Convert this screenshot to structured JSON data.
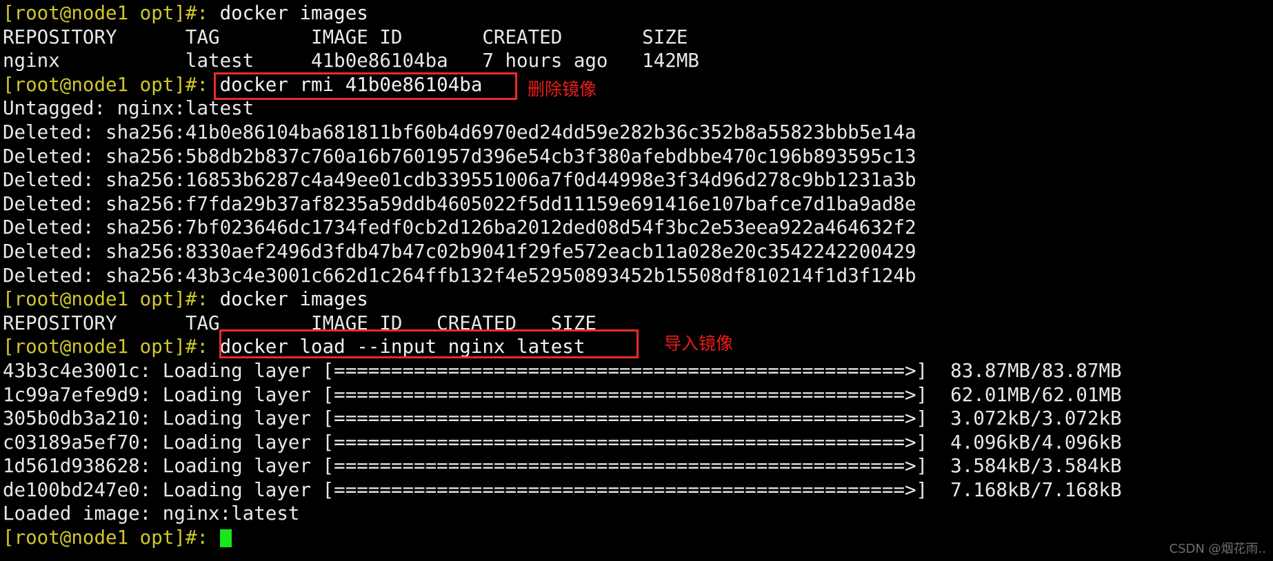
{
  "terminal": {
    "prompt": "[root@node1 opt]#:",
    "colors": {
      "background": "#000000",
      "prompt": "#d2c72b",
      "output": "#e8e8e8",
      "cursor": "#19e619",
      "annotation": "#ef1a1a",
      "highlight_border": "#ee2b2b"
    },
    "lines": {
      "l01_cmd": " docker images",
      "l02": "REPOSITORY      TAG        IMAGE ID       CREATED       SIZE",
      "l03": "nginx           latest     41b0e86104ba   7 hours ago   142MB",
      "l04_cmd": " docker rmi 41b0e86104ba",
      "l05": "Untagged: nginx:latest",
      "l06": "Deleted: sha256:41b0e86104ba681811bf60b4d6970ed24dd59e282b36c352b8a55823bbb5e14a",
      "l07": "Deleted: sha256:5b8db2b837c760a16b7601957d396e54cb3f380afebdbbe470c196b893595c13",
      "l08": "Deleted: sha256:16853b6287c4a49ee01cdb339551006a7f0d44998e3f34d96d278c9bb1231a3b",
      "l09": "Deleted: sha256:f7fda29b37af8235a59ddb4605022f5dd11159e691416e107bafce7d1ba9ad8e",
      "l10": "Deleted: sha256:7bf023646dc1734fedf0cb2d126ba2012ded08d54f3bc2e53eea922a464632f2",
      "l11": "Deleted: sha256:8330aef2496d3fdb47b47c02b9041f29fe572eacb11a028e20c3542242200429",
      "l12": "Deleted: sha256:43b3c4e3001c662d1c264ffb132f4e52950893452b15508df810214f1d3f124b",
      "l13_cmd": " docker images",
      "l14": "REPOSITORY      TAG        IMAGE ID   CREATED   SIZE",
      "l15_cmd": " docker load --input nginx_latest",
      "l16": "43b3c4e3001c: Loading layer [==================================================>]  83.87MB/83.87MB",
      "l17": "1c99a7efe9d9: Loading layer [==================================================>]  62.01MB/62.01MB",
      "l18": "305b0db3a210: Loading layer [==================================================>]  3.072kB/3.072kB",
      "l19": "c03189a5ef70: Loading layer [==================================================>]  4.096kB/4.096kB",
      "l20": "1d561d938628: Loading layer [==================================================>]  3.584kB/3.584kB",
      "l21": "de100bd247e0: Loading layer [==================================================>]  7.168kB/7.168kB",
      "l22": "Loaded image: nginx:latest"
    },
    "annotations": {
      "delete_image": "删除镜像",
      "import_image": "导入镜像"
    },
    "watermark": "CSDN @烟花雨.."
  }
}
